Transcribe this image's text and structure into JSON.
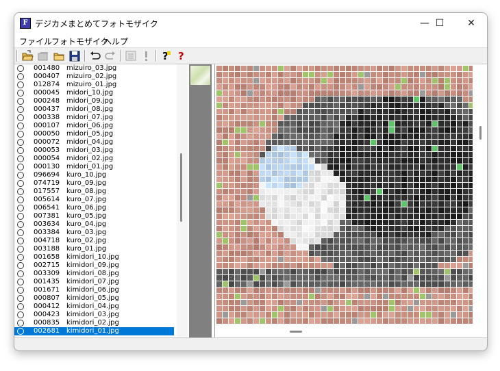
{
  "window": {
    "title": "デジカメまとめてフォトモザイク",
    "app_icon_letter": "F",
    "controls": {
      "minimize": "—",
      "maximize": "☐",
      "close": "✕"
    }
  },
  "menu": [
    {
      "label": "ファイル"
    },
    {
      "label": "フォトモザイク"
    },
    {
      "label": "ヘルプ"
    }
  ],
  "toolbar": [
    {
      "icon": "open-folder-icon",
      "enabled": true
    },
    {
      "icon": "gallery-icon",
      "enabled": false
    },
    {
      "icon": "folder-icon",
      "enabled": true
    },
    {
      "icon": "save-icon",
      "enabled": true
    },
    {
      "icon": "undo-icon",
      "enabled": true
    },
    {
      "icon": "redo-icon",
      "enabled": false
    },
    {
      "icon": "list-icon",
      "enabled": false
    },
    {
      "icon": "exclamation-icon",
      "enabled": false
    },
    {
      "icon": "help-icon",
      "enabled": true
    },
    {
      "icon": "context-help-icon",
      "enabled": true
    }
  ],
  "file_list": [
    {
      "code": "001480",
      "name": "mizuiro_03.jpg"
    },
    {
      "code": "000407",
      "name": "mizuiro_02.jpg"
    },
    {
      "code": "012874",
      "name": "mizuiro_01.jpg"
    },
    {
      "code": "000045",
      "name": "midori_10.jpg"
    },
    {
      "code": "000248",
      "name": "midori_09.jpg"
    },
    {
      "code": "000437",
      "name": "midori_08.jpg"
    },
    {
      "code": "000338",
      "name": "midori_07.jpg"
    },
    {
      "code": "000107",
      "name": "midori_06.jpg"
    },
    {
      "code": "000050",
      "name": "midori_05.jpg"
    },
    {
      "code": "000072",
      "name": "midori_04.jpg"
    },
    {
      "code": "000053",
      "name": "midori_03.jpg"
    },
    {
      "code": "000054",
      "name": "midori_02.jpg"
    },
    {
      "code": "000130",
      "name": "midori_01.jpg"
    },
    {
      "code": "096694",
      "name": "kuro_10.jpg"
    },
    {
      "code": "074719",
      "name": "kuro_09.jpg"
    },
    {
      "code": "017557",
      "name": "kuro_08.jpg"
    },
    {
      "code": "005614",
      "name": "kuro_07.jpg"
    },
    {
      "code": "006541",
      "name": "kuro_06.jpg"
    },
    {
      "code": "007381",
      "name": "kuro_05.jpg"
    },
    {
      "code": "003634",
      "name": "kuro_04.jpg"
    },
    {
      "code": "003384",
      "name": "kuro_03.jpg"
    },
    {
      "code": "004718",
      "name": "kuro_02.jpg"
    },
    {
      "code": "003188",
      "name": "kuro_01.jpg"
    },
    {
      "code": "001658",
      "name": "kimidori_10.jpg"
    },
    {
      "code": "002715",
      "name": "kimidori_09.jpg"
    },
    {
      "code": "003309",
      "name": "kimidori_08.jpg"
    },
    {
      "code": "001435",
      "name": "kimidori_07.jpg"
    },
    {
      "code": "001671",
      "name": "kimidori_06.jpg"
    },
    {
      "code": "000807",
      "name": "kimidori_05.jpg"
    },
    {
      "code": "000412",
      "name": "kimidori_04.jpg"
    },
    {
      "code": "000423",
      "name": "kimidori_03.jpg"
    },
    {
      "code": "000835",
      "name": "kimidori_02.jpg"
    },
    {
      "code": "002681",
      "name": "kimidori_01.jpg",
      "selected": true
    }
  ],
  "colors": {
    "selection": "#0078d7",
    "skin": "#c98f80",
    "eye_dark": "#2c2c2c",
    "eye_mid": "#5a5a5a",
    "sclera": "#e6e6e6",
    "highlight": "#b9d3ee"
  }
}
